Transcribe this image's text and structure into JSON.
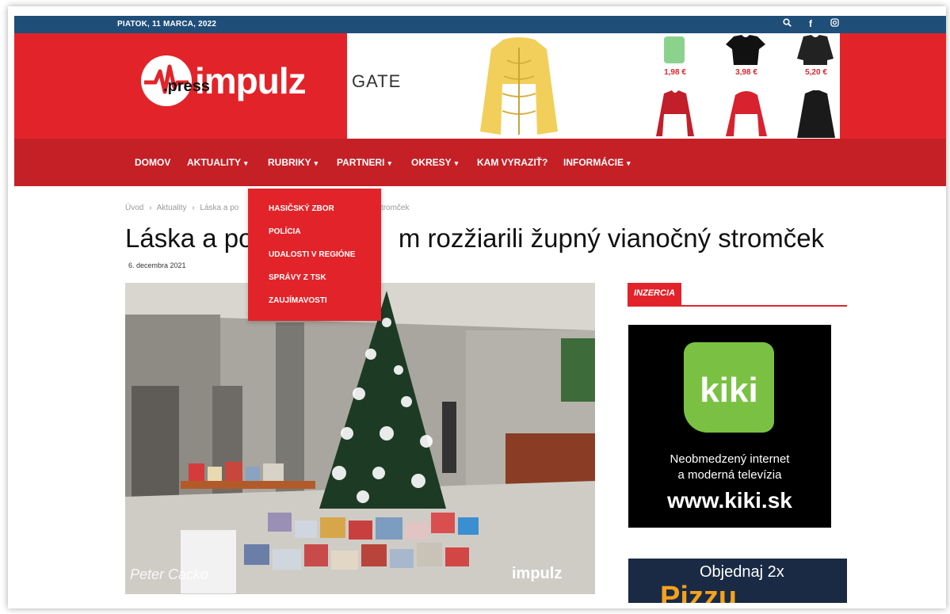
{
  "topbar": {
    "date": "PIATOK, 11 MARCA, 2022",
    "icons": [
      "search-icon",
      "facebook-icon",
      "instagram-icon"
    ]
  },
  "logo": {
    "main": "impulz",
    "sub": ".press"
  },
  "banner": {
    "brand": "GATE",
    "prices": [
      "1,98 €",
      "3,98 €",
      "5,20 €"
    ]
  },
  "nav": {
    "items": [
      {
        "label": "DOMOV",
        "has_dropdown": false
      },
      {
        "label": "AKTUALITY",
        "has_dropdown": true
      },
      {
        "label": "RUBRIKY",
        "has_dropdown": true
      },
      {
        "label": "PARTNERI",
        "has_dropdown": true
      },
      {
        "label": "OKRESY",
        "has_dropdown": true
      },
      {
        "label": "KAM VYRAZIŤ?",
        "has_dropdown": false
      },
      {
        "label": "INFORMÁCIE",
        "has_dropdown": true
      }
    ],
    "chevron": "⌄"
  },
  "dropdown": {
    "items": [
      "HASIČSKÝ ZBOR",
      "POLÍCIA",
      "UDALOSTI V REGIÓNE",
      "SPRÁVY Z TSK",
      "ZAUJÍMAVOSTI"
    ]
  },
  "breadcrumb": {
    "items": [
      "Úvod",
      "›",
      "Aktuality",
      "›",
      "Láska a po",
      "y stromček"
    ]
  },
  "article": {
    "title": "Láska a po                    m rozžiarili župný vianočný stromček",
    "date": "6. decembra 2021",
    "photo_credit": "Peter Cacko",
    "photo_logo": "impulz"
  },
  "sidebar": {
    "section_label": "INZERCIA",
    "kiki": {
      "logo": "kiki",
      "tagline": "Neobmedzený internet",
      "tagline2": "a moderná televízia",
      "url": "www.kiki.sk"
    },
    "pizza": {
      "line1": "Objednaj 2x",
      "line2": "Pizzu"
    }
  },
  "colors": {
    "brand_red": "#e2242a",
    "nav_red": "#c52026",
    "topbar_blue": "#1f4e79",
    "kiki_green": "#7ac143"
  }
}
